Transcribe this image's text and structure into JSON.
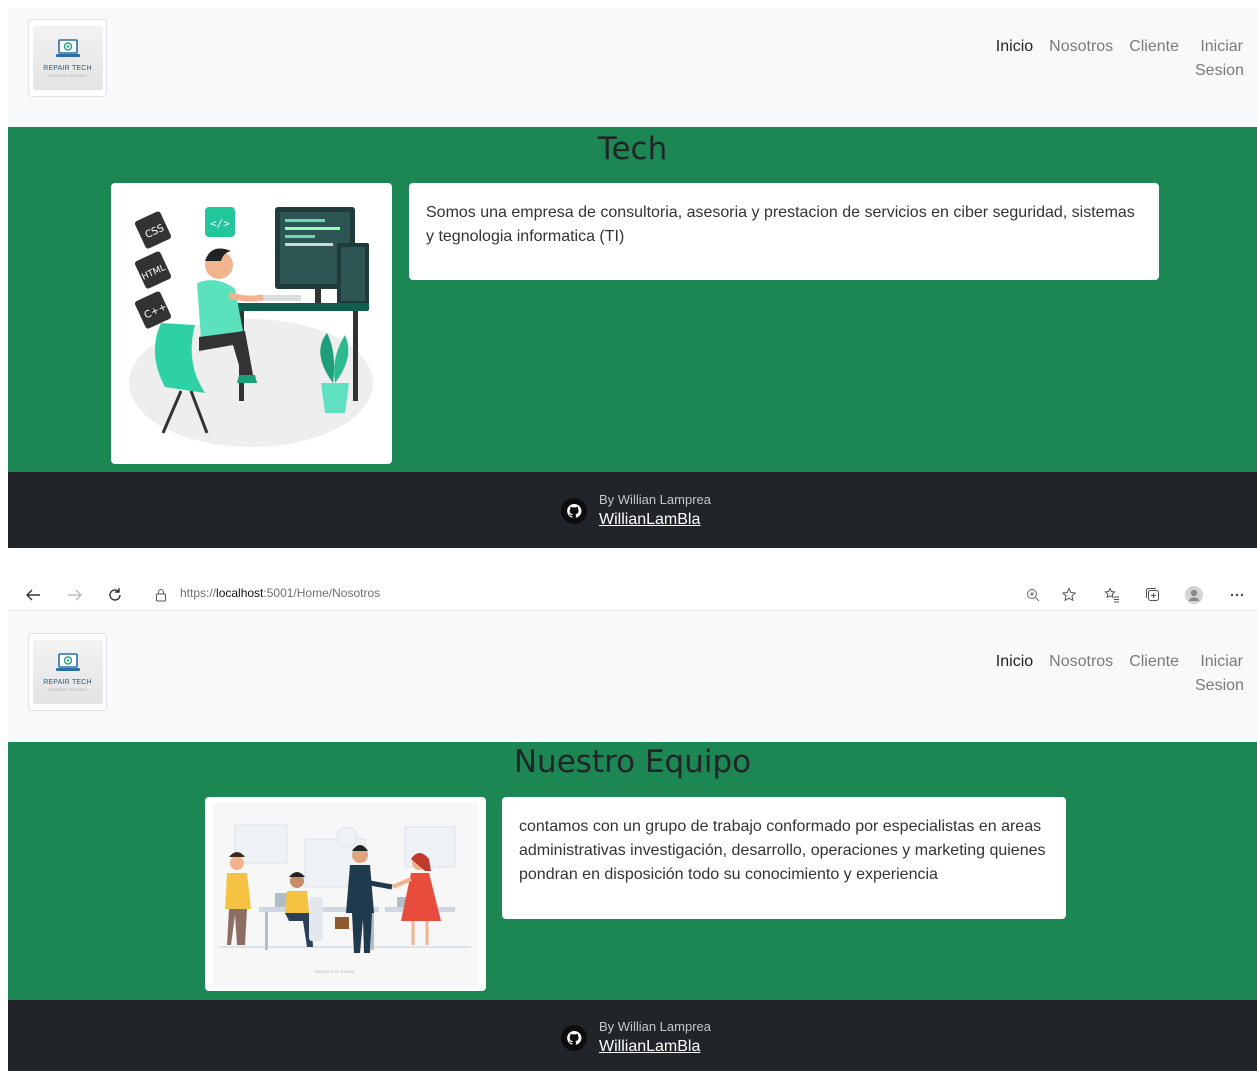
{
  "brand": {
    "logo_text": "REPAIR TECH",
    "logo_sub": "SOPORTE TÉCNICO"
  },
  "nav": {
    "items": [
      {
        "label": "Inicio"
      },
      {
        "label": "Nosotros"
      },
      {
        "label": "Cliente"
      }
    ],
    "iniciar_line1": "Iniciar",
    "iniciar_line2": "Sesion"
  },
  "panel1": {
    "title": "Tech",
    "text": "Somos una empresa de consultoria, asesoria y prestacion de servicios en ciber seguridad, sistemas y tegnologia informatica (TI)",
    "badges": [
      "CSS",
      "HTML",
      "C++"
    ]
  },
  "panel2": {
    "title": "Nuestro Equipo",
    "text": "contamos con un grupo de trabajo conformado por especialistas en areas administrativas investigación, desarrollo, operaciones y marketing quienes pondran en disposición todo su conocimiento y experiencia"
  },
  "footer": {
    "by": "By Willian Lamprea",
    "link": "WillianLamBla"
  },
  "browser": {
    "url_prefix": "https://",
    "url_host": "localhost",
    "url_rest": ":5001/Home/Nosotros"
  },
  "colors": {
    "hero_green": "#1d8754",
    "footer_dark": "#212529",
    "nav_bg": "#f8f9fa"
  }
}
